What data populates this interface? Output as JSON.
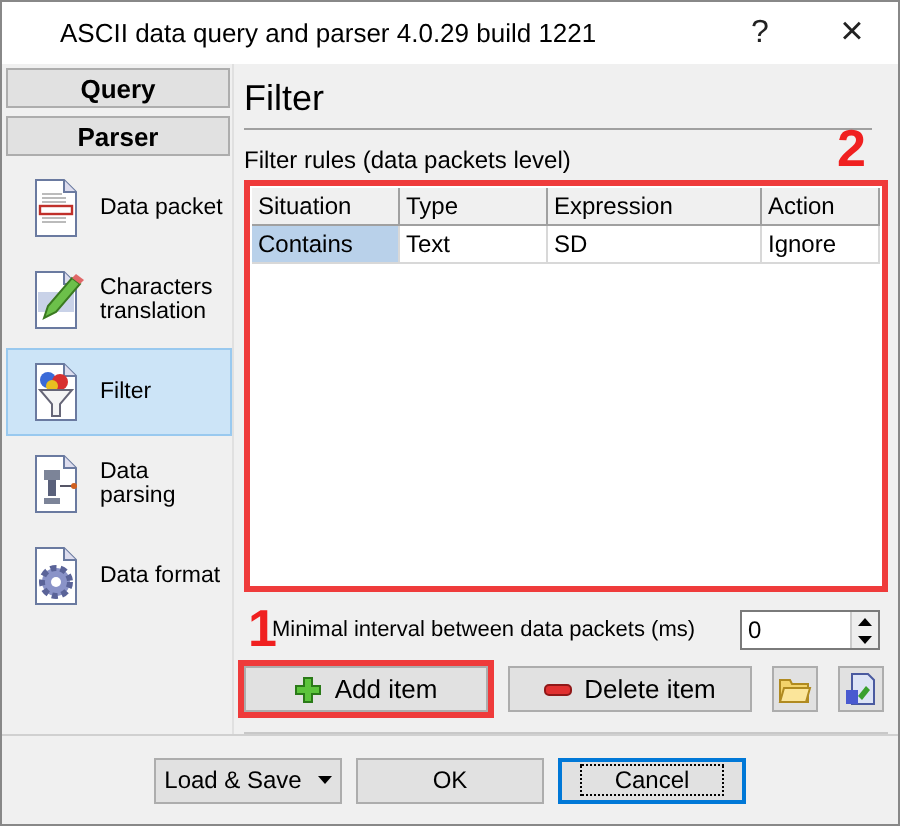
{
  "window": {
    "title": "ASCII data query and parser 4.0.29 build 1221",
    "help": "?",
    "close": "×"
  },
  "sidebar": {
    "sections": [
      {
        "label": "Query"
      },
      {
        "label": "Parser"
      }
    ],
    "items": [
      {
        "label": "Data packet",
        "kind": "packet",
        "selected": false
      },
      {
        "label": "Characters translation",
        "kind": "pencil",
        "selected": false
      },
      {
        "label": "Filter",
        "kind": "funnel",
        "selected": true
      },
      {
        "label": "Data parsing",
        "kind": "parsing",
        "selected": false
      },
      {
        "label": "Data format",
        "kind": "gear",
        "selected": false
      }
    ]
  },
  "panel": {
    "title": "Filter",
    "table_label": "Filter rules (data packets level)",
    "table": {
      "highlighted": true,
      "annotation": "2",
      "columns": [
        "Situation",
        "Type",
        "Expression",
        "Action"
      ],
      "rows": [
        {
          "cells": [
            {
              "text": "Contains",
              "selected": true
            },
            {
              "text": "Text",
              "selected": false
            },
            {
              "text": "SD",
              "selected": false
            },
            {
              "text": "Ignore",
              "selected": false
            }
          ]
        }
      ]
    },
    "interval": {
      "label": "Minimal interval between data packets (ms)",
      "value": "0"
    },
    "actions": [
      {
        "label": "Add item",
        "kind": "add",
        "highlighted": true,
        "annotation": "1"
      },
      {
        "label": "Delete item",
        "kind": "delete",
        "highlighted": false
      }
    ]
  },
  "footer": {
    "buttons": [
      {
        "label": "Load & Save",
        "kind": "menu",
        "focused": false
      },
      {
        "label": "OK",
        "kind": "plain",
        "focused": false
      },
      {
        "label": "Cancel",
        "kind": "plain",
        "focused": true
      }
    ]
  }
}
